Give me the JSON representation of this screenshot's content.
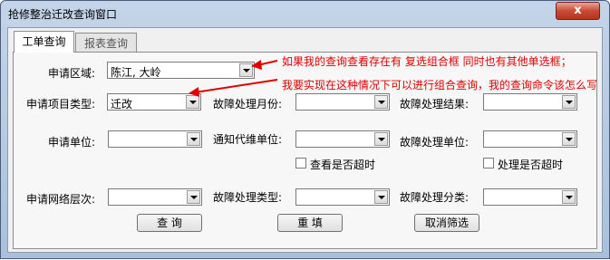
{
  "window": {
    "title": "抢修整治迁改查询窗口",
    "close_glyph": "x"
  },
  "tabs": [
    {
      "label": "工单查询"
    },
    {
      "label": "报表查询"
    }
  ],
  "fields": {
    "apply_region": {
      "label": "申请区域:",
      "value": "陈江, 大岭"
    },
    "project_type": {
      "label": "申请项目类型:",
      "value": "迁改"
    },
    "fault_month": {
      "label": "故障处理月份:",
      "value": ""
    },
    "fault_result": {
      "label": "故障处理结果:",
      "value": ""
    },
    "apply_unit": {
      "label": "申请单位:",
      "value": ""
    },
    "notify_unit": {
      "label": "通知代维单位:",
      "value": ""
    },
    "fault_unit": {
      "label": "故障处理单位:",
      "value": ""
    },
    "net_level": {
      "label": "申请网络层次:",
      "value": ""
    },
    "fault_type": {
      "label": "故障处理类型:",
      "value": ""
    },
    "fault_class": {
      "label": "故障处理分类:",
      "value": ""
    }
  },
  "checkboxes": {
    "check_timeout": {
      "label": "查看是否超时",
      "checked": false
    },
    "process_timeout": {
      "label": "处理是否超时",
      "checked": false
    }
  },
  "buttons": {
    "query": "查  询",
    "reset": "重  填",
    "cancel_filter": "取消筛选"
  },
  "annotations": {
    "line1": "如果我的查询查看存在有  复选组合框  同时也有其他单选框；",
    "line2": "我要实现在这种情况下可以进行组合查询，我的查询命令该怎么写"
  },
  "colors": {
    "annotation": "#e00000",
    "close_button": "#c94b35"
  }
}
